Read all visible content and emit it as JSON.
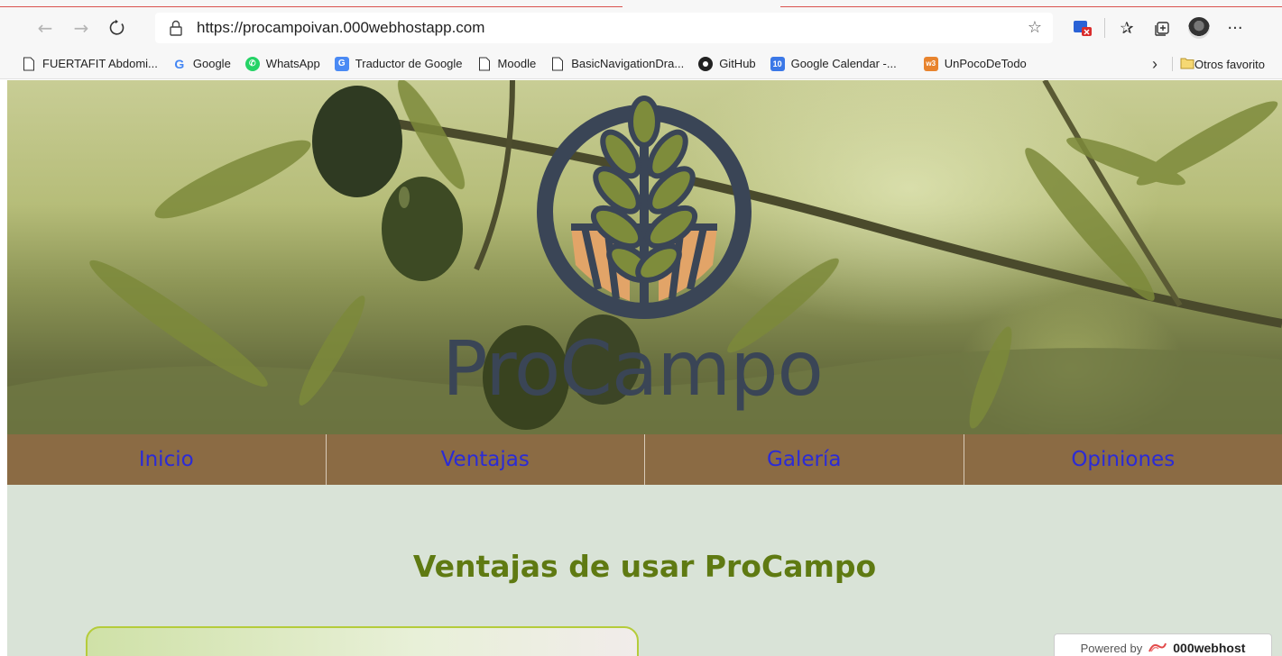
{
  "browser": {
    "url": "https://procampoivan.000webhostapp.com",
    "bookmarks": [
      {
        "label": "FUERTAFIT Abdomi...",
        "icon": "page-icon"
      },
      {
        "label": "Google",
        "icon": "google-icon"
      },
      {
        "label": "WhatsApp",
        "icon": "whatsapp-icon"
      },
      {
        "label": "Traductor de Google",
        "icon": "google-translate-icon"
      },
      {
        "label": "Moodle",
        "icon": "page-icon"
      },
      {
        "label": "BasicNavigationDra...",
        "icon": "page-icon"
      },
      {
        "label": "GitHub",
        "icon": "github-icon"
      },
      {
        "label": "Google Calendar -...",
        "icon": "google-calendar-icon"
      },
      {
        "label": "UnPocoDeTodo",
        "icon": "w3schools-icon"
      }
    ],
    "other_favorites": "Otros favorito",
    "calendar_day": "10",
    "w3_badge": "w3"
  },
  "site": {
    "brand": "ProCampo",
    "menu": [
      "Inicio",
      "Ventajas",
      "Galería",
      "Opiniones"
    ],
    "section_title": "Ventajas de usar ProCampo",
    "powered_by": "Powered by",
    "powered_brand": "000webhost"
  },
  "colors": {
    "logo": "#3a4556",
    "field": "#e2a468",
    "leaf": "#7e8c3b",
    "menu_bg": "#8b6b44",
    "menu_link": "#2b2bd6",
    "section_title": "#5f7a12",
    "page_bg": "#d9e3d7"
  }
}
